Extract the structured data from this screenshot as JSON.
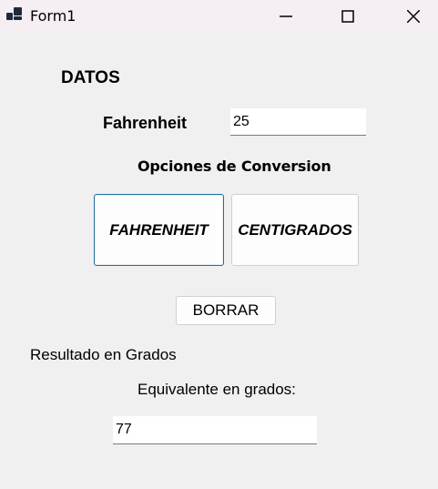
{
  "window": {
    "title": "Form1",
    "icons": {
      "app": "app-icon",
      "minimize": "minimize-icon",
      "maximize": "maximize-icon",
      "close": "close-icon"
    }
  },
  "form": {
    "section_title": "DATOS",
    "fahrenheit_label": "Fahrenheit",
    "fahrenheit_value": "25",
    "options_title": "Opciones de Conversion",
    "option_fahrenheit_label": "FAHRENHEIT",
    "option_centigrados_label": "CENTIGRADOS",
    "clear_label": "BORRAR",
    "result_title": "Resultado en Grados",
    "equivalent_label": "Equivalente en grados:",
    "result_value": "77"
  },
  "colors": {
    "background": "#f0f0f0",
    "titlebar": "#f5eef2",
    "focus_border": "#1f6f9a"
  }
}
